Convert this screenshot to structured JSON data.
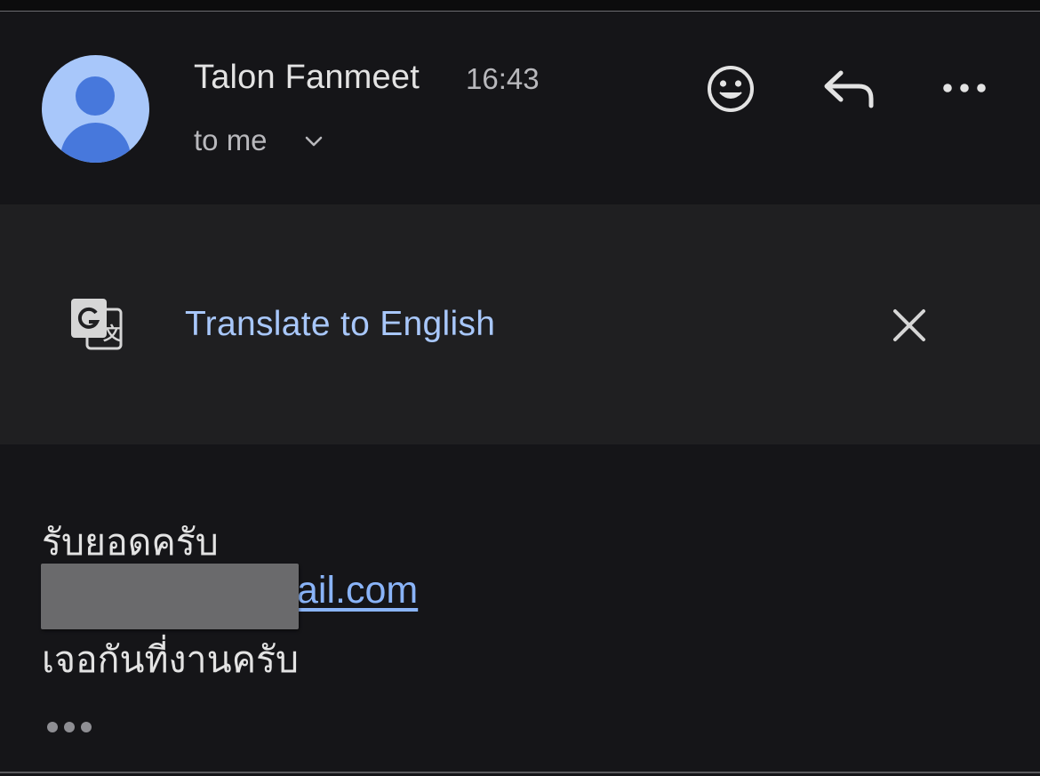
{
  "message": {
    "sender_name": "Talon Fanmeet",
    "time": "16:43",
    "recipient": "to me",
    "avatar_color": "#a8c7fa",
    "avatar_figure_color": "#4778dc"
  },
  "header_actions": {
    "react": "smiley-icon",
    "reply": "reply-icon",
    "more": "more-horizontal-icon"
  },
  "translate_banner": {
    "label": "Translate to English",
    "icon": "google-translate-icon",
    "close": "close-icon",
    "accent_color": "#a8c7fa"
  },
  "body": {
    "line1": "รับยอดครับ",
    "line2_visible_link": "ail.com",
    "line3": "เจอกันที่งานครับ",
    "link_color": "#8ab4f8",
    "expand": "show-trimmed-content-icon"
  }
}
